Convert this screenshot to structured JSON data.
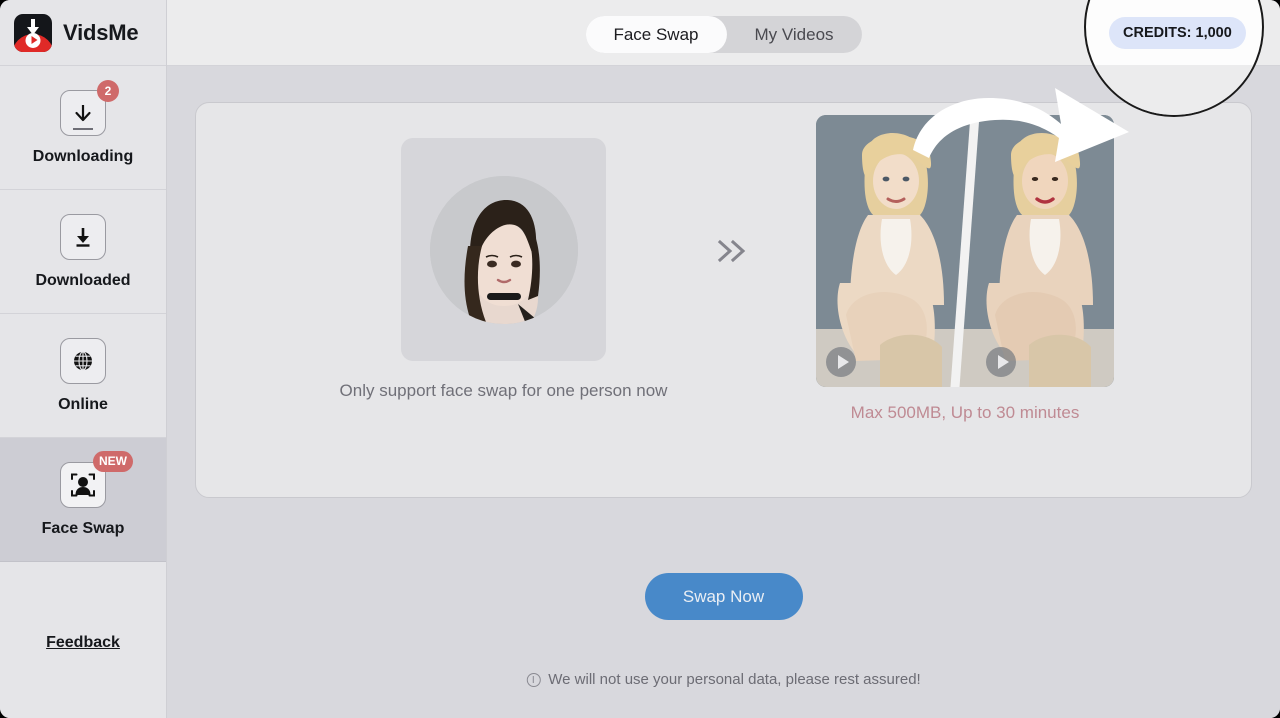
{
  "app": {
    "brand_name": "VidsMe",
    "logo_icon": "vidsme-download-logo"
  },
  "sidebar": {
    "items": [
      {
        "label": "Downloading",
        "icon": "download-arrow-icon",
        "badge": "2",
        "badge_type": "count",
        "active": false
      },
      {
        "label": "Downloaded",
        "icon": "download-tray-icon",
        "badge": "",
        "badge_type": "none",
        "active": false
      },
      {
        "label": "Online",
        "icon": "globe-icon",
        "badge": "",
        "badge_type": "none",
        "active": false
      },
      {
        "label": "Face Swap",
        "icon": "face-frame-icon",
        "badge": "NEW",
        "badge_type": "tag",
        "active": true
      }
    ],
    "feedback_label": "Feedback"
  },
  "header": {
    "tabs": [
      {
        "label": "Face Swap",
        "active": true
      },
      {
        "label": "My Videos",
        "active": false
      }
    ],
    "credits_label": "CREDITS: 1,000",
    "credits_bg": "#dde5f9",
    "highlight_icon": "magnifier-highlight-circle",
    "pointer_icon": "curved-arrow-icon"
  },
  "main": {
    "face_slot": {
      "icon": "portrait-thumbnail",
      "caption": "Only support face swap for one person now"
    },
    "transition_icon": "double-chevron-right-icon",
    "video_slot": {
      "icon": "video-thumbnail-pair",
      "play_icon": "play-icon",
      "caption": "Max 500MB, Up to 30 minutes",
      "caption_color": "#bf8a93"
    },
    "swap_button_label": "Swap Now",
    "swap_button_color": "#4889c9",
    "privacy_icon": "info-circle-icon",
    "privacy_note": "We will not use your personal data, please rest assured!"
  }
}
